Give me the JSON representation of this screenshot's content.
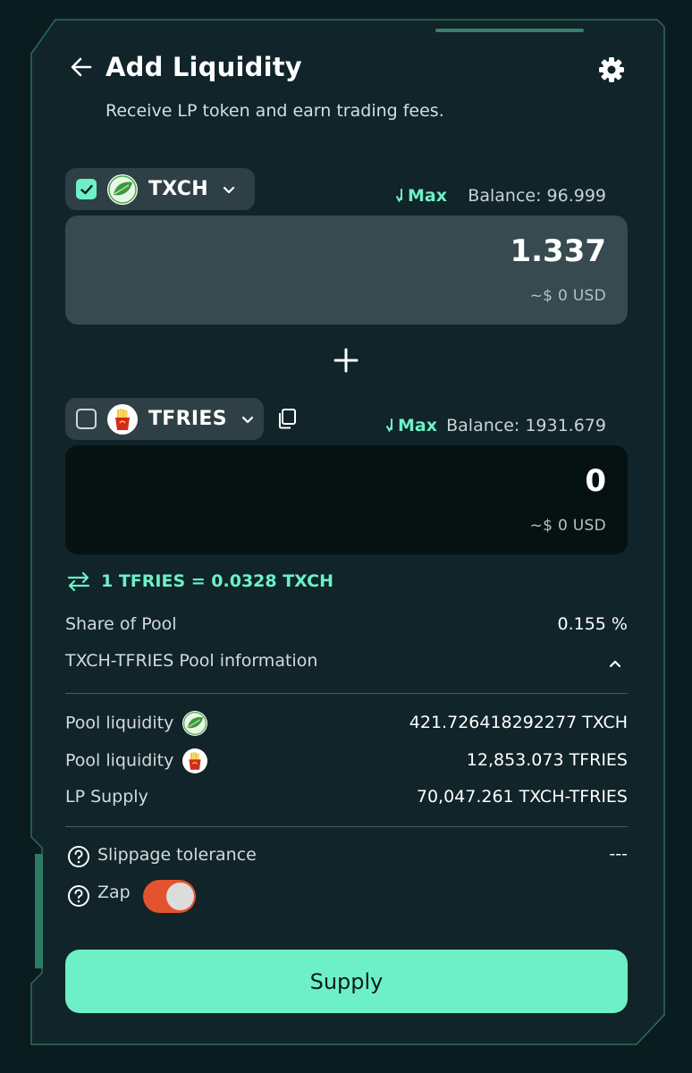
{
  "header": {
    "title": "Add Liquidity",
    "subtitle": "Receive LP token and earn trading fees."
  },
  "token_a": {
    "name": "TXCH",
    "checked": true,
    "max_label": "Max",
    "balance_text": "Balance: 96.999",
    "amount": "1.337",
    "usd": "~$ 0 USD"
  },
  "token_b": {
    "name": "TFRIES",
    "checked": false,
    "max_label": "Max",
    "balance_text": "Balance: 1931.679",
    "amount": "0",
    "usd": "~$ 0 USD"
  },
  "rate": "1 TFRIES = 0.0328 TXCH",
  "share": {
    "label": "Share of Pool",
    "value": "0.155 %"
  },
  "pool_info": {
    "label": "TXCH-TFRIES Pool information",
    "expanded": true,
    "rows": [
      {
        "label": "Pool liquidity",
        "icon": "leaf-icon",
        "value": "421.726418292277 TXCH"
      },
      {
        "label": "Pool liquidity",
        "icon": "fries-icon",
        "value": "12,853.073 TFRIES"
      },
      {
        "label": "LP Supply",
        "icon": "",
        "value": "70,047.261 TXCH-TFRIES"
      }
    ]
  },
  "slippage": {
    "label": "Slippage tolerance",
    "value": "---"
  },
  "zap": {
    "label": "Zap",
    "enabled": true
  },
  "supply_label": "Supply",
  "colors": {
    "background": "#0b1c20",
    "card": "#102429",
    "accent": "#6ef0c7",
    "toggle": "#e3532f",
    "input_a": "#364a4f",
    "input_b": "#051211"
  }
}
